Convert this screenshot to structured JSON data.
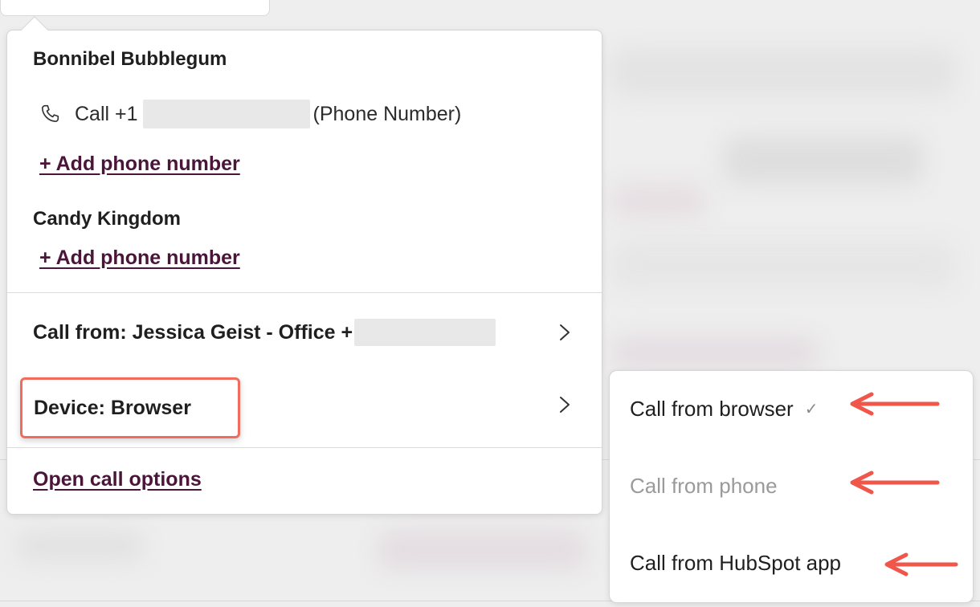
{
  "contact": {
    "name": "Bonnibel Bubblegum",
    "call_prefix": "Call +1",
    "call_suffix": "(Phone Number)",
    "add_phone_label": "+ Add phone number"
  },
  "company": {
    "name": "Candy Kingdom",
    "add_phone_label": "+ Add phone number"
  },
  "call_from": {
    "label": "Call from: Jessica Geist - Office +"
  },
  "device": {
    "label": "Device: Browser"
  },
  "open_options_label": "Open call options",
  "submenu": {
    "items": [
      {
        "label": "Call from browser",
        "selected": true,
        "disabled": false
      },
      {
        "label": "Call from phone",
        "selected": false,
        "disabled": true
      },
      {
        "label": "Call from HubSpot app",
        "selected": false,
        "disabled": false
      }
    ],
    "check_glyph": "✓"
  },
  "colors": {
    "link": "#4a1538",
    "highlight": "#f26b5b",
    "annotation_arrow": "#f0564a",
    "disabled_text": "#9a9a9a"
  },
  "icons": {
    "phone": "phone-icon",
    "chevron": "chevron-right-icon",
    "check": "check-icon",
    "annotation_arrow": "arrow-left-icon"
  }
}
